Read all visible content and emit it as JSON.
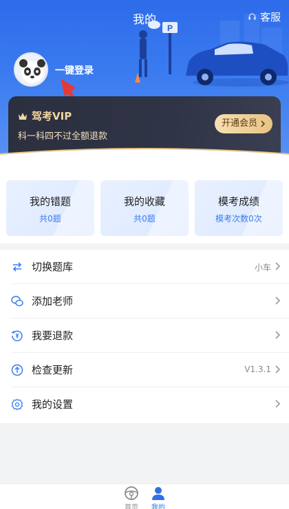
{
  "header": {
    "title": "我的",
    "service_label": "客服"
  },
  "user": {
    "login_label": "一键登录"
  },
  "vip": {
    "name": "驾考VIP",
    "subtitle": "科一科四不过全额退款",
    "button_label": "开通会员"
  },
  "stats": [
    {
      "title": "我的错题",
      "value": "共0题"
    },
    {
      "title": "我的收藏",
      "value": "共0题"
    },
    {
      "title": "模考成绩",
      "value": "模考次数0次"
    }
  ],
  "menu": [
    {
      "label": "切换题库",
      "value": "小车",
      "icon": "swap-icon"
    },
    {
      "label": "添加老师",
      "value": "",
      "icon": "wechat-icon"
    },
    {
      "label": "我要退款",
      "value": "",
      "icon": "refund-icon"
    },
    {
      "label": "检查更新",
      "value": "V1.3.1",
      "icon": "upload-icon"
    },
    {
      "label": "我的设置",
      "value": "",
      "icon": "gear-icon"
    }
  ],
  "tabbar": [
    {
      "label": "首页",
      "icon": "steering-wheel-icon",
      "active": false
    },
    {
      "label": "我的",
      "icon": "user-icon",
      "active": true
    }
  ],
  "colors": {
    "primary": "#3a7cf0",
    "vip_gold": "#f2d7a0",
    "annotation_red": "#e53935"
  }
}
